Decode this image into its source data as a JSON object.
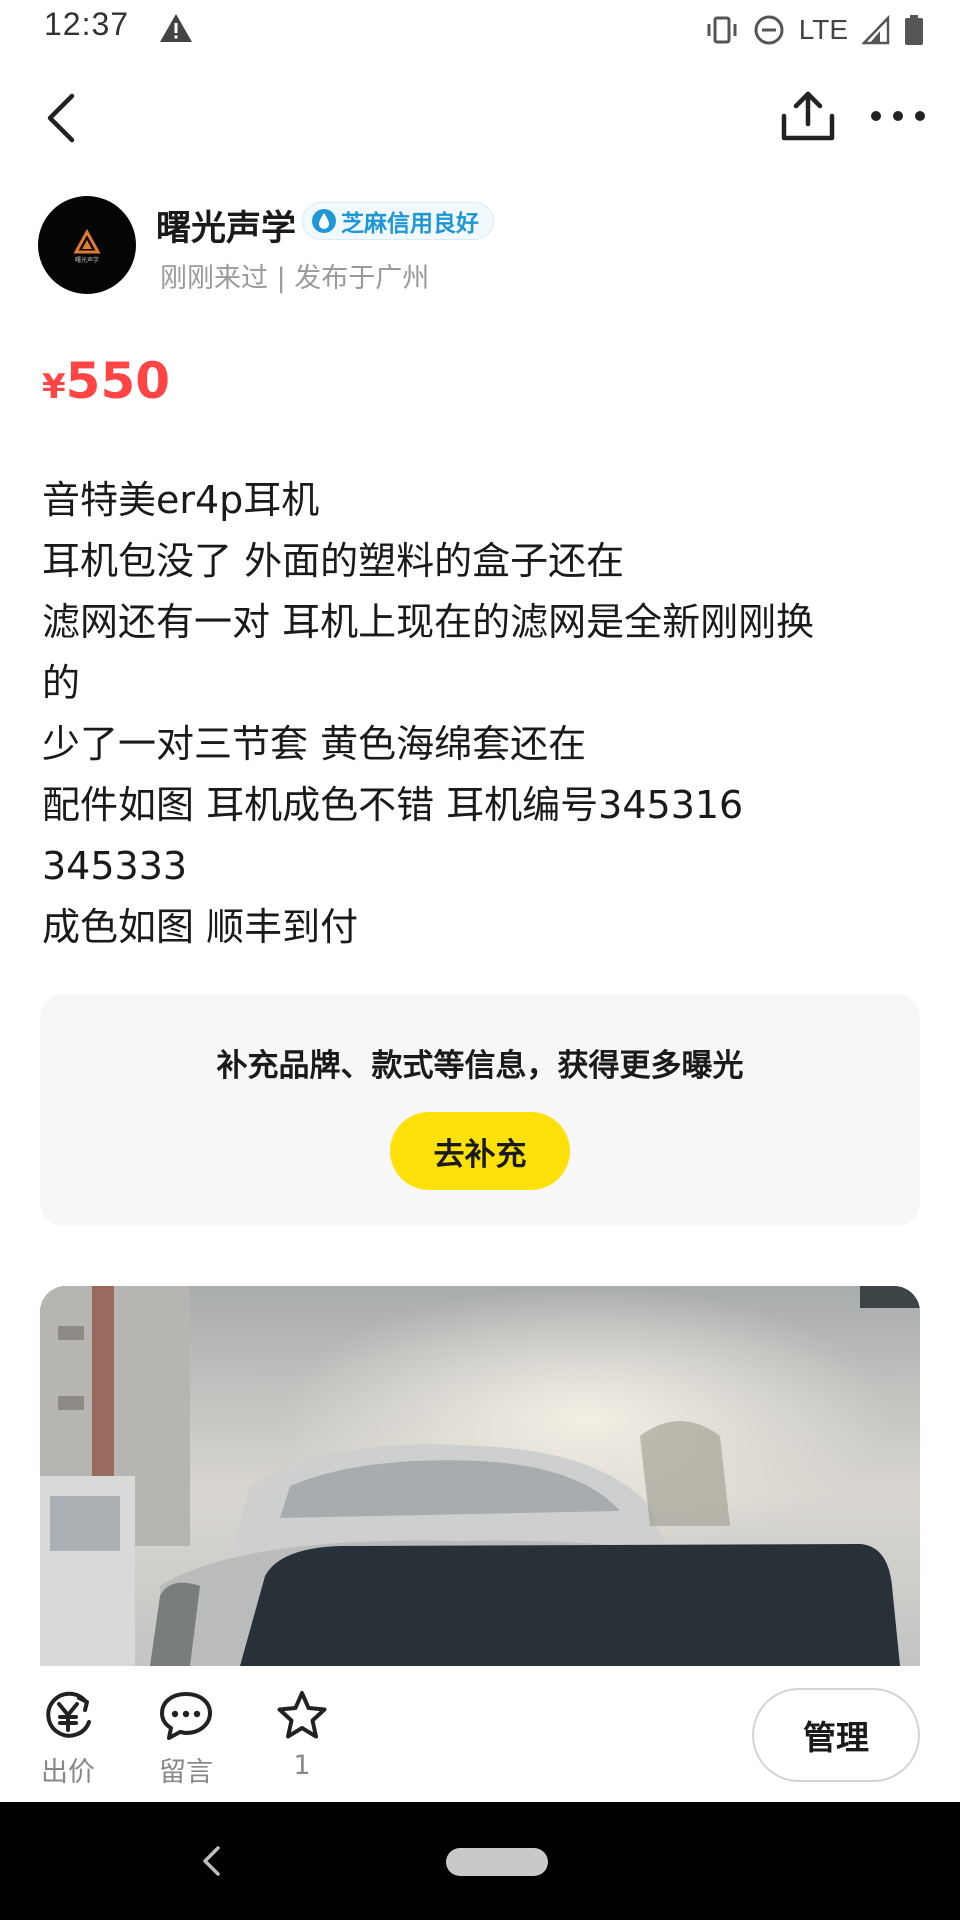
{
  "status_bar": {
    "time": "12:37",
    "network": "LTE",
    "icons": [
      "alert-icon",
      "vibrate-icon",
      "dnd-icon",
      "signal-icon",
      "battery-icon"
    ]
  },
  "nav": {
    "icons": [
      "back-icon",
      "share-icon",
      "more-icon"
    ]
  },
  "seller": {
    "name": "曙光声学",
    "credit_badge": "芝麻信用良好",
    "meta": "刚刚来过 | 发布于广州",
    "avatar_text": "曙光声学"
  },
  "price": {
    "currency": "¥",
    "value": "550"
  },
  "description": [
    "音特美er4p耳机",
    "耳机包没了 外面的塑料的盒子还在",
    "滤网还有一对 耳机上现在的滤网是全新刚刚换",
    "的",
    "少了一对三节套 黄色海绵套还在",
    "配件如图 耳机成色不错 耳机编号345316",
    "345333",
    "成色如图 顺丰到付"
  ],
  "supplement": {
    "text": "补充品牌、款式等信息，获得更多曝光",
    "button": "去补充"
  },
  "actions": {
    "offer": "出价",
    "comment": "留言",
    "favorite_count": "1",
    "manage": "管理"
  },
  "colors": {
    "price": "#ff4444",
    "accent_yellow": "#ffe10a",
    "credit_blue": "#1f97d6"
  }
}
